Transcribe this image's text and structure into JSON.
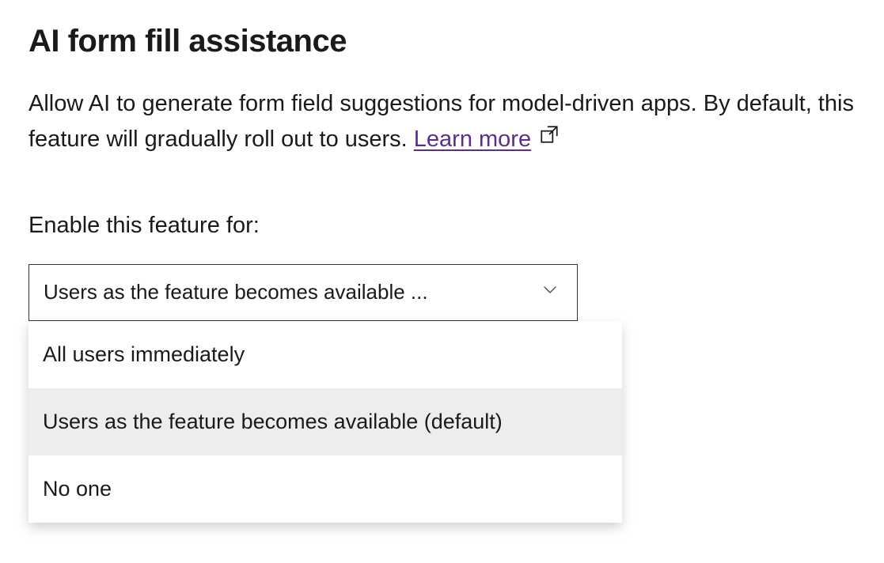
{
  "heading": "AI form fill assistance",
  "description": "Allow AI to generate form field suggestions for model-driven apps. By default, this feature will gradually roll out to users. ",
  "learn_more_label": "Learn more",
  "learn_more_color": "#5c2d91",
  "field_label": "Enable this feature for:",
  "combobox": {
    "selected_display": "Users as the feature becomes available ..."
  },
  "options": [
    {
      "label": "All users immediately",
      "selected": false
    },
    {
      "label": "Users as the feature becomes available (default)",
      "selected": true
    },
    {
      "label": "No one",
      "selected": false
    }
  ]
}
